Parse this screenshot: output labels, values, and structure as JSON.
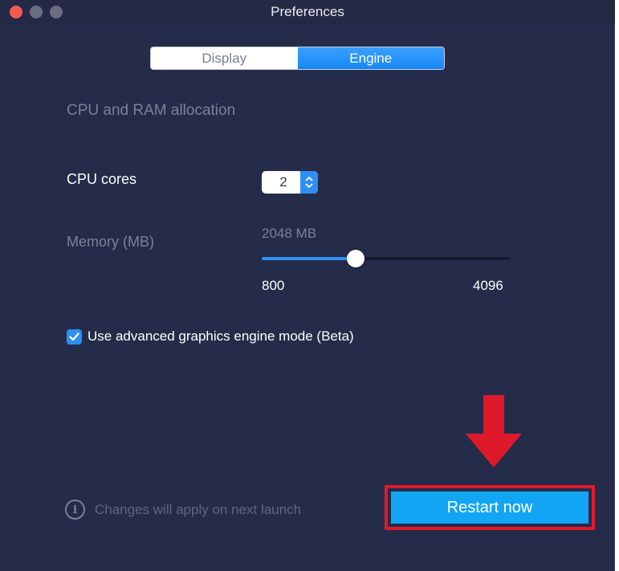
{
  "window": {
    "title": "Preferences"
  },
  "tabs": [
    {
      "label": "Display",
      "active": false
    },
    {
      "label": "Engine",
      "active": true
    }
  ],
  "section": {
    "title": "CPU and RAM allocation"
  },
  "cpu": {
    "label": "CPU cores",
    "value": "2"
  },
  "memory": {
    "label": "Memory (MB)",
    "current_display": "2048 MB",
    "value": 2048,
    "min": 800,
    "max": 4096,
    "min_label": "800",
    "max_label": "4096"
  },
  "graphics": {
    "checked": true,
    "label": "Use advanced graphics engine mode (Beta)"
  },
  "footer": {
    "info_text": "Changes will apply on next launch",
    "restart_label": "Restart now"
  },
  "colors": {
    "accent": "#2f8ff3",
    "restart": "#12a5f4",
    "highlight": "#e0192a",
    "background": "#252c4a"
  },
  "icons": [
    "close-dot",
    "minimize-dot",
    "zoom-dot",
    "stepper-arrows-icon",
    "checkmark-icon",
    "info-icon",
    "down-arrow-icon"
  ]
}
